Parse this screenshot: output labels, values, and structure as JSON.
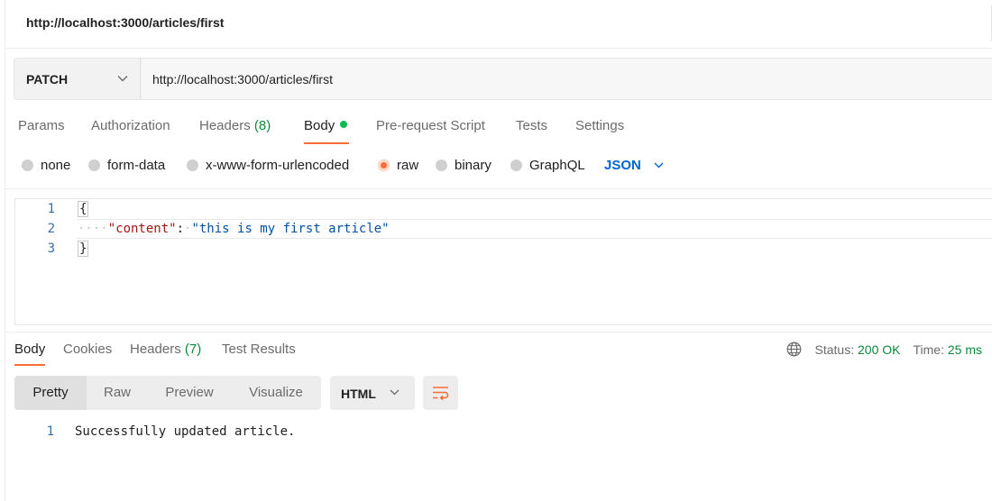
{
  "window": {
    "title": "http://localhost:3000/articles/first"
  },
  "request": {
    "method": "PATCH",
    "url": "http://localhost:3000/articles/first"
  },
  "request_tabs": [
    {
      "label": "Params"
    },
    {
      "label": "Authorization"
    },
    {
      "label": "Headers",
      "count": "(8)"
    },
    {
      "label": "Body"
    },
    {
      "label": "Pre-request Script"
    },
    {
      "label": "Tests"
    },
    {
      "label": "Settings"
    }
  ],
  "body_options": {
    "items": [
      "none",
      "form-data",
      "x-www-form-urlencoded",
      "raw",
      "binary",
      "GraphQL"
    ],
    "selected": "raw",
    "format": "JSON"
  },
  "editor": {
    "lines": [
      {
        "number": "1",
        "open": "{"
      },
      {
        "number": "2",
        "key": "\"content\"",
        "colon": ":",
        "value": "\"this is my first article\""
      },
      {
        "number": "3",
        "close": "}"
      }
    ]
  },
  "response": {
    "tabs": [
      {
        "label": "Body"
      },
      {
        "label": "Cookies"
      },
      {
        "label": "Headers",
        "count": "(7)"
      },
      {
        "label": "Test Results"
      }
    ],
    "status_label": "Status:",
    "status_value": "200 OK",
    "time_label": "Time:",
    "time_value": "25 ms",
    "view_modes": [
      "Pretty",
      "Raw",
      "Preview",
      "Visualize"
    ],
    "format": "HTML",
    "lines": [
      {
        "number": "1",
        "text": "Successfully updated article."
      }
    ]
  },
  "colors": {
    "accent": "#ff6c37",
    "success": "#0a8a3a",
    "link": "#0265d2"
  }
}
